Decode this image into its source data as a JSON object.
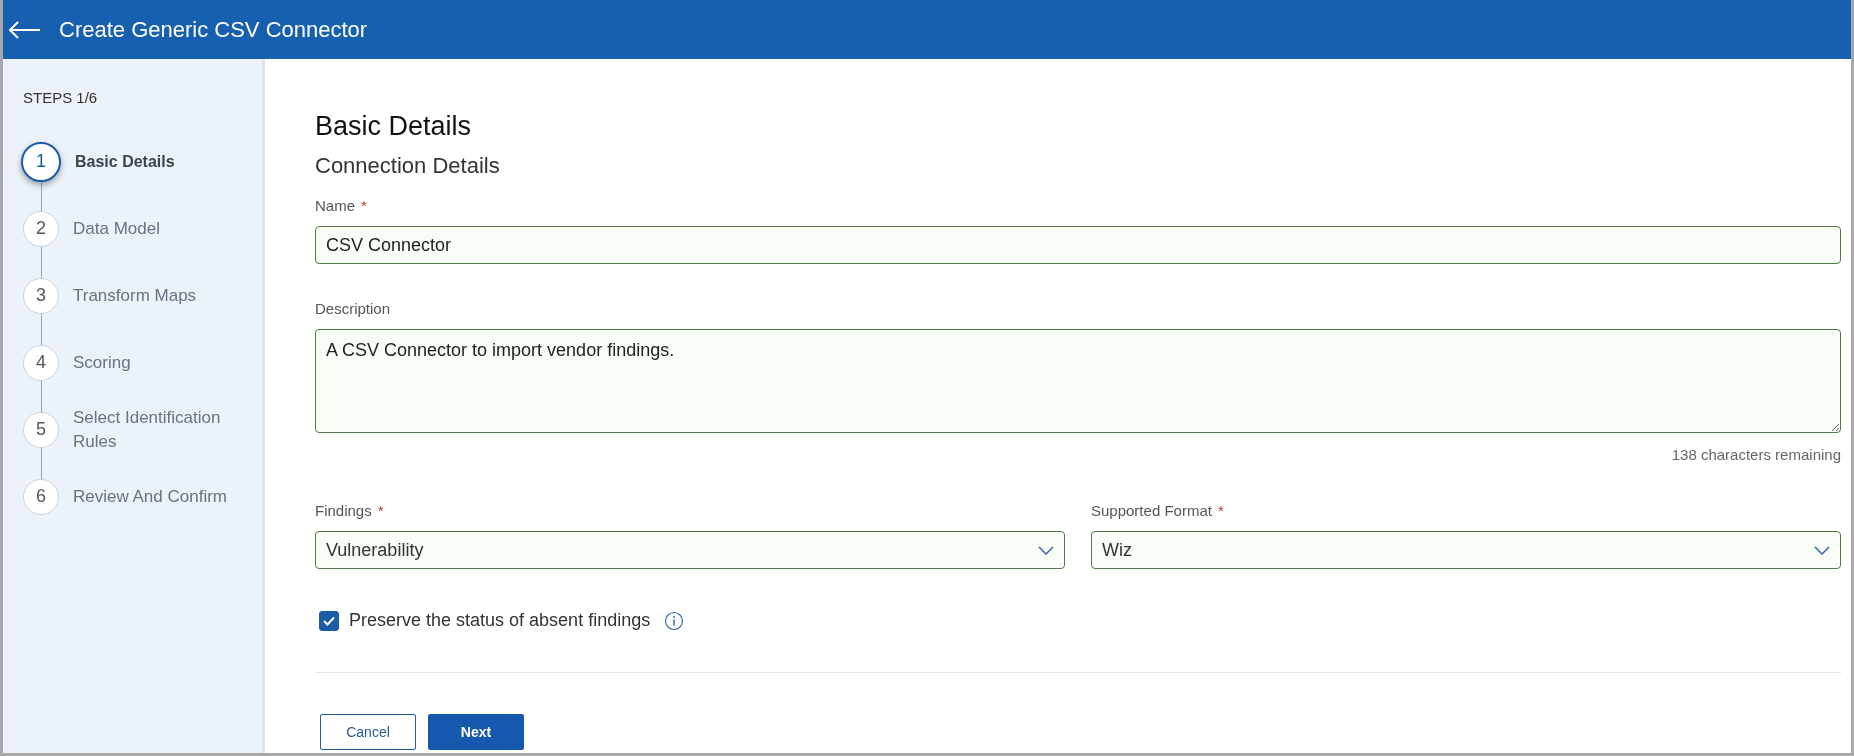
{
  "header": {
    "title": "Create Generic CSV Connector"
  },
  "sidebar": {
    "steps_label": "STEPS 1/6",
    "steps": [
      {
        "number": "1",
        "label": "Basic Details",
        "selected": true
      },
      {
        "number": "2",
        "label": "Data Model",
        "selected": false
      },
      {
        "number": "3",
        "label": "Transform Maps",
        "selected": false
      },
      {
        "number": "4",
        "label": "Scoring",
        "selected": false
      },
      {
        "number": "5",
        "label": "Select Identification Rules",
        "selected": false
      },
      {
        "number": "6",
        "label": "Review And Confirm",
        "selected": false
      }
    ]
  },
  "form": {
    "title": "Basic Details",
    "subtitle": "Connection Details",
    "name": {
      "label": "Name",
      "required_mark": "*",
      "value": "CSV Connector"
    },
    "description": {
      "label": "Description",
      "value": "A CSV Connector to import vendor findings.",
      "counter": "138 characters remaining"
    },
    "selects": [
      {
        "label": "Findings",
        "required_mark": "*",
        "value": "Vulnerability"
      },
      {
        "label": "Supported Format",
        "required_mark": "*",
        "value": "Wiz"
      }
    ],
    "checkbox": {
      "label": "Preserve the status of absent findings",
      "checked": true
    },
    "buttons": [
      {
        "label": "Cancel",
        "kind": "secondary"
      },
      {
        "label": "Next",
        "kind": "primary"
      }
    ]
  }
}
